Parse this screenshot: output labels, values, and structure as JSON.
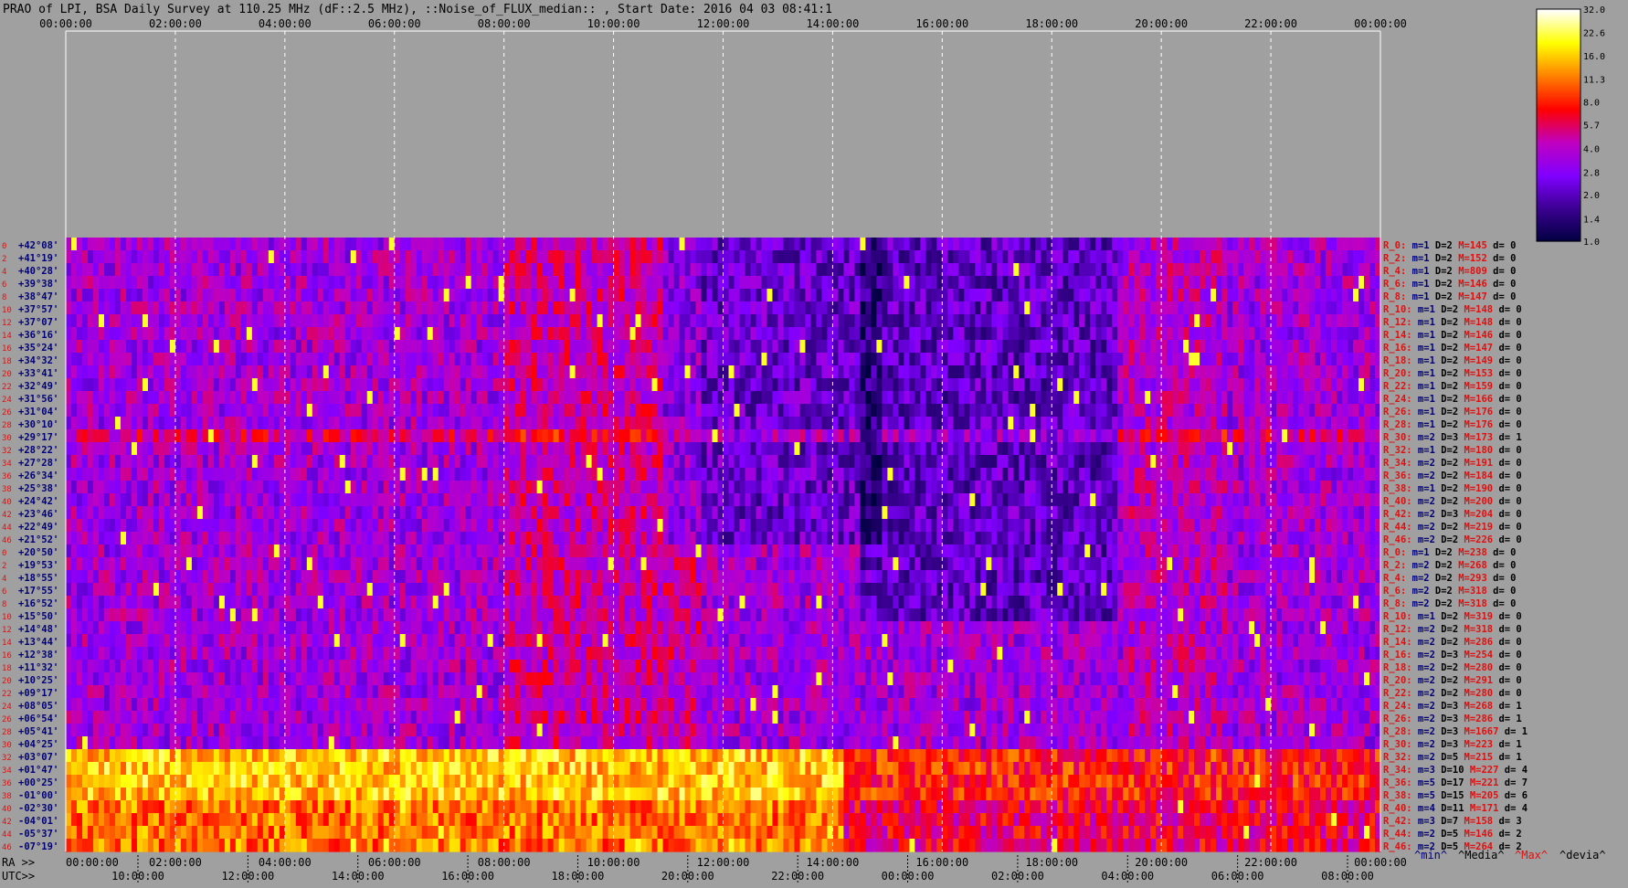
{
  "chart_data": {
    "type": "heatmap",
    "title": "PRAO of LPI, BSA Daily Survey at 110.25 MHz (dF::2.5 MHz), ::Noise_of_FLUX_median:: , Start Date: 2016 04 03 08:41:1",
    "top_ticks": [
      "00:00:00",
      "02:00:00",
      "04:00:00",
      "06:00:00",
      "08:00:00",
      "10:00:00",
      "12:00:00",
      "14:00:00",
      "16:00:00",
      "18:00:00",
      "20:00:00",
      "22:00:00",
      "00:00:00"
    ],
    "ra_label": "RA >>",
    "ra_ticks": [
      "00:00:00",
      "02:00:00",
      "04:00:00",
      "06:00:00",
      "08:00:00",
      "10:00:00",
      "12:00:00",
      "14:00:00",
      "16:00:00",
      "18:00:00",
      "20:00:00",
      "22:00:00",
      "00:00:00"
    ],
    "utc_label": "UTC>>",
    "utc_ticks": [
      "10:00:00",
      "12:00:00",
      "14:00:00",
      "16:00:00",
      "18:00:00",
      "20:00:00",
      "22:00:00",
      "00:00:00",
      "02:00:00",
      "04:00:00",
      "06:00:00",
      "08:00:00"
    ],
    "row_numbers": [
      "0",
      "2",
      "4",
      "6",
      "8",
      "10",
      "12",
      "14",
      "16",
      "18",
      "20",
      "22",
      "24",
      "26",
      "28",
      "30",
      "32",
      "34",
      "36",
      "38",
      "40",
      "42",
      "44",
      "46",
      "0",
      "2",
      "4",
      "6",
      "8",
      "10",
      "12",
      "14",
      "16",
      "18",
      "20",
      "22",
      "24",
      "26",
      "28",
      "30",
      "32",
      "34",
      "36",
      "38",
      "40",
      "42",
      "44",
      "46"
    ],
    "declinations": [
      "+42°08'",
      "+41°19'",
      "+40°28'",
      "+39°38'",
      "+38°47'",
      "+37°57'",
      "+37°07'",
      "+36°16'",
      "+35°24'",
      "+34°32'",
      "+33°41'",
      "+32°49'",
      "+31°56'",
      "+31°04'",
      "+30°10'",
      "+29°17'",
      "+28°22'",
      "+27°28'",
      "+26°34'",
      "+25°38'",
      "+24°42'",
      "+23°46'",
      "+22°49'",
      "+21°52'",
      "+20°50'",
      "+19°53'",
      "+18°55'",
      "+17°55'",
      "+16°52'",
      "+15°50'",
      "+14°48'",
      "+13°44'",
      "+12°38'",
      "+11°32'",
      "+10°25'",
      "+09°17'",
      "+08°05'",
      "+06°54'",
      "+05°41'",
      "+04°25'",
      "+03°07'",
      "+01°47'",
      "+00°25'",
      "-01°00'",
      "-02°30'",
      "-04°01'",
      "-05°37'",
      "-07°19'"
    ],
    "colorbar_ticks": [
      "32.0",
      "22.6",
      "16.0",
      "11.3",
      "8.0",
      "5.7",
      "4.0",
      "2.8",
      "2.0",
      "1.4",
      "1.0"
    ],
    "colorbar_range": [
      1.0,
      32.0
    ],
    "colorbar_scale": "log",
    "colormap": [
      "#000040",
      "#3a0090",
      "#8000ff",
      "#c000c0",
      "#ff0000",
      "#ff8000",
      "#ffff00",
      "#ffffff"
    ],
    "legend_footer": {
      "min": "^min^",
      "media": "^Media^",
      "max": "^Max^",
      "devia": "^devia^"
    },
    "rows": [
      {
        "r": "R_0:",
        "m": "m=1",
        "D": "D=2",
        "M": "M=145",
        "d": "d= 0"
      },
      {
        "r": "R_2:",
        "m": "m=1",
        "D": "D=2",
        "M": "M=152",
        "d": "d= 0"
      },
      {
        "r": "R_4:",
        "m": "m=1",
        "D": "D=2",
        "M": "M=809",
        "d": "d= 0"
      },
      {
        "r": "R_6:",
        "m": "m=1",
        "D": "D=2",
        "M": "M=146",
        "d": "d= 0"
      },
      {
        "r": "R_8:",
        "m": "m=1",
        "D": "D=2",
        "M": "M=147",
        "d": "d= 0"
      },
      {
        "r": "R_10:",
        "m": "m=1",
        "D": "D=2",
        "M": "M=148",
        "d": "d= 0"
      },
      {
        "r": "R_12:",
        "m": "m=1",
        "D": "D=2",
        "M": "M=148",
        "d": "d= 0"
      },
      {
        "r": "R_14:",
        "m": "m=1",
        "D": "D=2",
        "M": "M=146",
        "d": "d= 0"
      },
      {
        "r": "R_16:",
        "m": "m=1",
        "D": "D=2",
        "M": "M=147",
        "d": "d= 0"
      },
      {
        "r": "R_18:",
        "m": "m=1",
        "D": "D=2",
        "M": "M=149",
        "d": "d= 0"
      },
      {
        "r": "R_20:",
        "m": "m=1",
        "D": "D=2",
        "M": "M=153",
        "d": "d= 0"
      },
      {
        "r": "R_22:",
        "m": "m=1",
        "D": "D=2",
        "M": "M=159",
        "d": "d= 0"
      },
      {
        "r": "R_24:",
        "m": "m=1",
        "D": "D=2",
        "M": "M=166",
        "d": "d= 0"
      },
      {
        "r": "R_26:",
        "m": "m=1",
        "D": "D=2",
        "M": "M=176",
        "d": "d= 0"
      },
      {
        "r": "R_28:",
        "m": "m=1",
        "D": "D=2",
        "M": "M=176",
        "d": "d= 0"
      },
      {
        "r": "R_30:",
        "m": "m=2",
        "D": "D=3",
        "M": "M=173",
        "d": "d= 1"
      },
      {
        "r": "R_32:",
        "m": "m=1",
        "D": "D=2",
        "M": "M=180",
        "d": "d= 0"
      },
      {
        "r": "R_34:",
        "m": "m=2",
        "D": "D=2",
        "M": "M=191",
        "d": "d= 0"
      },
      {
        "r": "R_36:",
        "m": "m=2",
        "D": "D=2",
        "M": "M=184",
        "d": "d= 0"
      },
      {
        "r": "R_38:",
        "m": "m=1",
        "D": "D=2",
        "M": "M=190",
        "d": "d= 0"
      },
      {
        "r": "R_40:",
        "m": "m=2",
        "D": "D=2",
        "M": "M=200",
        "d": "d= 0"
      },
      {
        "r": "R_42:",
        "m": "m=2",
        "D": "D=3",
        "M": "M=204",
        "d": "d= 0"
      },
      {
        "r": "R_44:",
        "m": "m=2",
        "D": "D=2",
        "M": "M=219",
        "d": "d= 0"
      },
      {
        "r": "R_46:",
        "m": "m=2",
        "D": "D=2",
        "M": "M=226",
        "d": "d= 0"
      },
      {
        "r": "R_0:",
        "m": "m=1",
        "D": "D=2",
        "M": "M=238",
        "d": "d= 0"
      },
      {
        "r": "R_2:",
        "m": "m=2",
        "D": "D=2",
        "M": "M=268",
        "d": "d= 0"
      },
      {
        "r": "R_4:",
        "m": "m=2",
        "D": "D=2",
        "M": "M=293",
        "d": "d= 0"
      },
      {
        "r": "R_6:",
        "m": "m=2",
        "D": "D=2",
        "M": "M=318",
        "d": "d= 0"
      },
      {
        "r": "R_8:",
        "m": "m=2",
        "D": "D=2",
        "M": "M=318",
        "d": "d= 0"
      },
      {
        "r": "R_10:",
        "m": "m=1",
        "D": "D=2",
        "M": "M=319",
        "d": "d= 0"
      },
      {
        "r": "R_12:",
        "m": "m=2",
        "D": "D=2",
        "M": "M=318",
        "d": "d= 0"
      },
      {
        "r": "R_14:",
        "m": "m=2",
        "D": "D=2",
        "M": "M=286",
        "d": "d= 0"
      },
      {
        "r": "R_16:",
        "m": "m=2",
        "D": "D=3",
        "M": "M=254",
        "d": "d= 0"
      },
      {
        "r": "R_18:",
        "m": "m=2",
        "D": "D=2",
        "M": "M=280",
        "d": "d= 0"
      },
      {
        "r": "R_20:",
        "m": "m=2",
        "D": "D=2",
        "M": "M=291",
        "d": "d= 0"
      },
      {
        "r": "R_22:",
        "m": "m=2",
        "D": "D=2",
        "M": "M=280",
        "d": "d= 0"
      },
      {
        "r": "R_24:",
        "m": "m=2",
        "D": "D=3",
        "M": "M=268",
        "d": "d= 1"
      },
      {
        "r": "R_26:",
        "m": "m=2",
        "D": "D=3",
        "M": "M=286",
        "d": "d= 1"
      },
      {
        "r": "R_28:",
        "m": "m=2",
        "D": "D=3",
        "M": "M=1667",
        "d": "d= 1"
      },
      {
        "r": "R_30:",
        "m": "m=2",
        "D": "D=3",
        "M": "M=223",
        "d": "d= 1"
      },
      {
        "r": "R_32:",
        "m": "m=2",
        "D": "D=5",
        "M": "M=215",
        "d": "d= 1"
      },
      {
        "r": "R_34:",
        "m": "m=3",
        "D": "D=10",
        "M": "M=227",
        "d": "d= 4"
      },
      {
        "r": "R_36:",
        "m": "m=5",
        "D": "D=17",
        "M": "M=221",
        "d": "d= 7"
      },
      {
        "r": "R_38:",
        "m": "m=5",
        "D": "D=15",
        "M": "M=205",
        "d": "d= 6"
      },
      {
        "r": "R_40:",
        "m": "m=4",
        "D": "D=11",
        "M": "M=171",
        "d": "d= 4"
      },
      {
        "r": "R_42:",
        "m": "m=3",
        "D": "D=7",
        "M": "M=158",
        "d": "d= 3"
      },
      {
        "r": "R_44:",
        "m": "m=2",
        "D": "D=5",
        "M": "M=146",
        "d": "d= 2"
      },
      {
        "r": "R_46:",
        "m": "m=2",
        "D": "D=5",
        "M": "M=264",
        "d": "d= 2"
      }
    ]
  },
  "colors": {
    "background": "#a0a0a0",
    "row_number": "#e01010",
    "declination": "#00007a",
    "right_r": "#e01010",
    "right_m": "#00007a",
    "right_D": "#000000",
    "right_M": "#e01010",
    "right_d": "#000000",
    "axis_text": "#000000",
    "grid": "#ffffff"
  }
}
